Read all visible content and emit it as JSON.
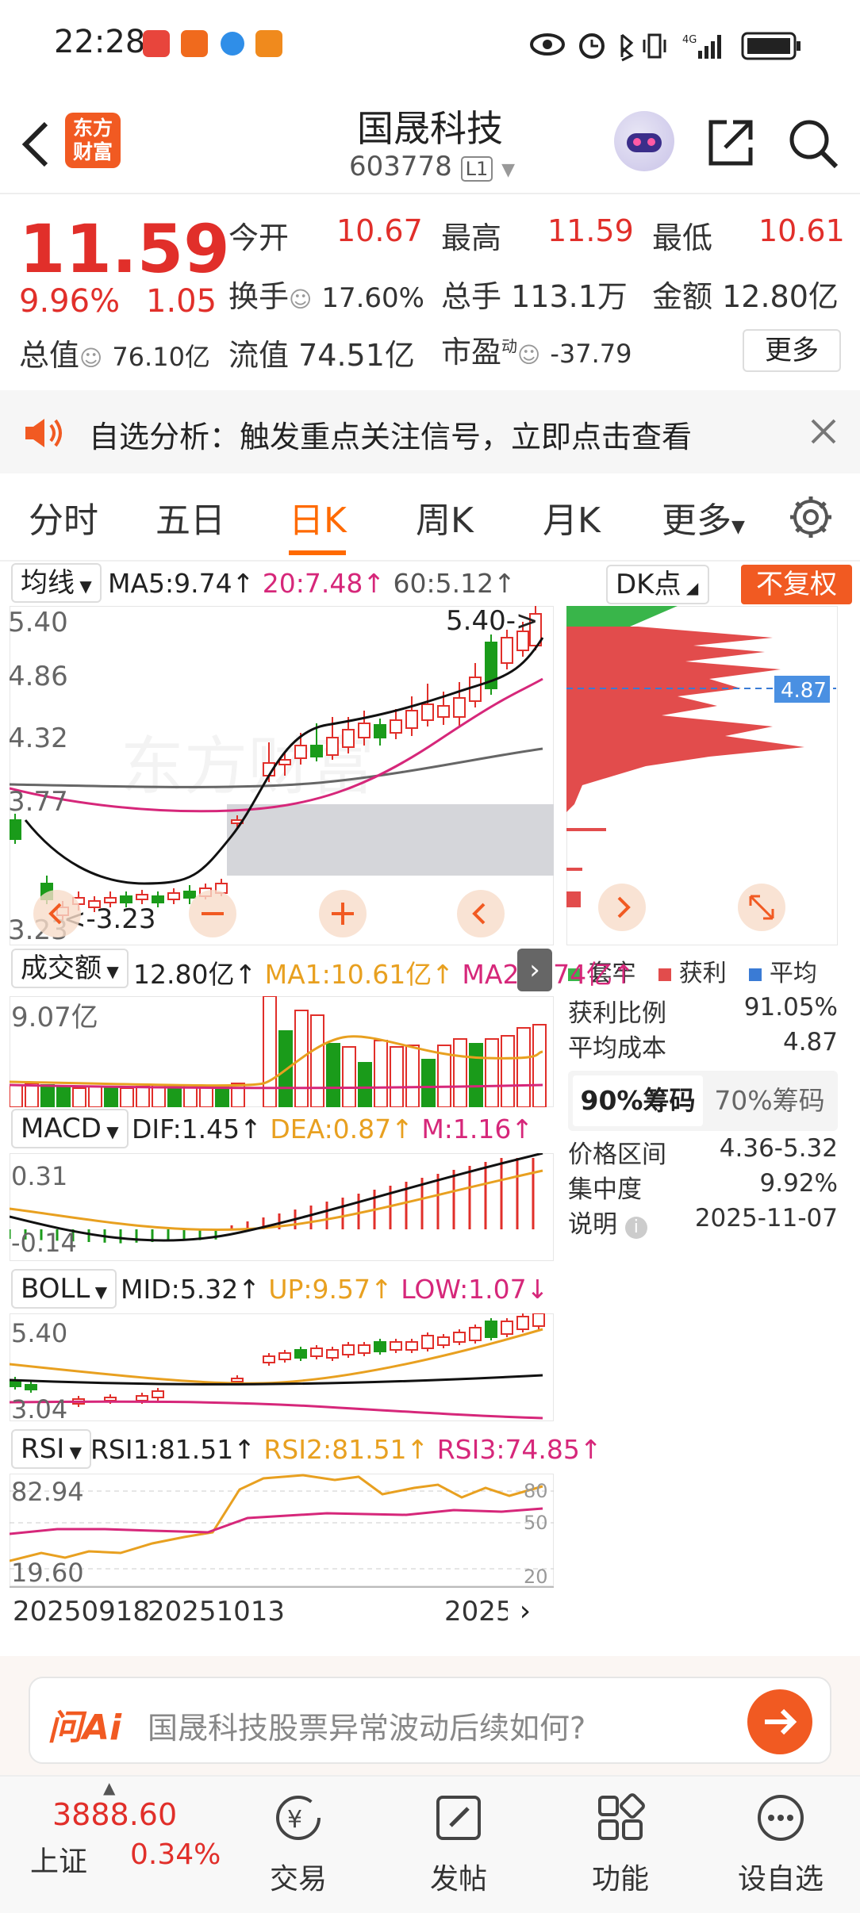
{
  "status_bar": {
    "time": "22:28",
    "signal": "4G"
  },
  "header": {
    "title": "国晟科技",
    "code": "603778",
    "level": "L1",
    "logo_text_1": "东方",
    "logo_text_2": "财富"
  },
  "quote": {
    "price": "11.59",
    "change_pct": "9.96%",
    "change": "1.05",
    "open_label": "今开",
    "open": "10.67",
    "high_label": "最高",
    "high": "11.59",
    "low_label": "最低",
    "low": "10.61",
    "turnover_label": "换手",
    "turnover": "17.60%",
    "volume_label": "总手",
    "volume": "113.1万",
    "amount_label": "金额",
    "amount": "12.80亿",
    "mktcap_label": "总值",
    "mktcap": "76.10亿",
    "float_label": "流值",
    "float": "74.51亿",
    "pe_label": "市盈",
    "pe_sup": "动",
    "pe": "-37.79",
    "more_button": "更多"
  },
  "banner": {
    "text": "自选分析：触发重点关注信号，立即点击查看"
  },
  "tabs": [
    "分时",
    "五日",
    "日K",
    "周K",
    "月K",
    "更多"
  ],
  "active_tab": "日K",
  "kline": {
    "selector": "均线",
    "ma5": "MA5:9.74↑",
    "ma20": "20:7.48↑",
    "ma60": "60:5.12↑",
    "dk_label": "DK点",
    "fq_label": "不复权",
    "y_labels": [
      "5.40",
      "4.86",
      "4.32",
      "3.77",
      "3.23"
    ],
    "high_mark": "5.40->",
    "low_mark": "<-3.23",
    "watermark": "东方财富"
  },
  "chip": {
    "current": "4.87",
    "legend": [
      "套牢",
      "获利",
      "平均"
    ]
  },
  "volume_panel": {
    "selector": "成交额",
    "val": "12.80亿↑",
    "ma1": "MA1:10.61亿↑",
    "ma2": "MA2:4.74亿↑",
    "y_label": "9.07亿"
  },
  "macd_panel": {
    "selector": "MACD",
    "dif": "DIF:1.45↑",
    "dea": "DEA:0.87↑",
    "m": "M:1.16↑",
    "y_top": "0.31",
    "y_bot": "-0.14"
  },
  "boll_panel": {
    "selector": "BOLL",
    "mid": "MID:5.32↑",
    "up": "UP:9.57↑",
    "low": "LOW:1.07↓",
    "y_top": "5.40",
    "y_bot": "3.04"
  },
  "rsi_panel": {
    "selector": "RSI",
    "rsi1": "RSI1:81.51↑",
    "rsi2": "RSI2:81.51↑",
    "rsi3": "RSI3:74.85↑",
    "y_top": "82.94",
    "y_bot": "19.60",
    "r80": "80",
    "r50": "50",
    "r20": "20"
  },
  "x_labels": [
    "20250918",
    "20251013",
    "2025"
  ],
  "chip_stats": {
    "profit_ratio_label": "获利比例",
    "profit_ratio": "91.05%",
    "avg_cost_label": "平均成本",
    "avg_cost": "4.87",
    "tab90": "90%筹码",
    "tab70": "70%筹码",
    "range_label": "价格区间",
    "range": "4.36-5.32",
    "concentration_label": "集中度",
    "concentration": "9.92%",
    "note_label": "说明",
    "note_date": "2025-11-07"
  },
  "ai": {
    "logo": "问Ai",
    "placeholder": "国晟科技股票异常波动后续如何?"
  },
  "bottom": {
    "index_value": "3888.60",
    "index_name": "上证",
    "index_pct": "0.34%",
    "trade": "交易",
    "post": "发帖",
    "func": "功能",
    "add": "设自选"
  },
  "colors": {
    "up": "#e12f2a",
    "down": "#1a9b1a",
    "accent": "#ff6a00"
  }
}
